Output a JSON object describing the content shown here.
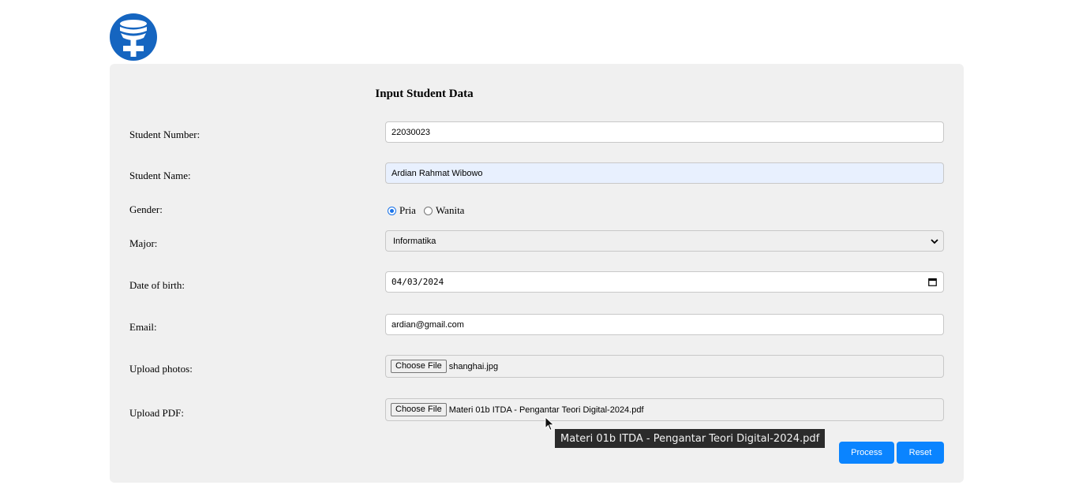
{
  "form": {
    "title": "Input Student Data",
    "student_number": {
      "label": "Student Number:",
      "value": "22030023"
    },
    "student_name": {
      "label": "Student Name:",
      "value": "Ardian Rahmat Wibowo"
    },
    "gender": {
      "label": "Gender:",
      "options": [
        {
          "label": "Pria",
          "checked": true
        },
        {
          "label": "Wanita",
          "checked": false
        }
      ]
    },
    "major": {
      "label": "Major:",
      "value": "Informatika"
    },
    "dob": {
      "label": "Date of birth:",
      "value": "04/03/2024"
    },
    "email": {
      "label": "Email:",
      "value": "ardian@gmail.com"
    },
    "photo": {
      "label": "Upload photos:",
      "button": "Choose File",
      "filename": "shanghai.jpg"
    },
    "pdf": {
      "label": "Upload PDF:",
      "button": "Choose File",
      "filename": "Materi 01b ITDA - Pengantar Teori Digital-2024.pdf"
    },
    "process_button": "Process",
    "reset_button": "Reset"
  },
  "tooltip": "Materi 01b ITDA - Pengantar Teori Digital-2024.pdf",
  "colors": {
    "primary": "#0a84ff",
    "logo": "#1565c0",
    "card_bg": "#f0f0f0",
    "autofill_bg": "#e8f0fe"
  },
  "icons": {
    "logo": "database-plus-icon",
    "select": "chevron-down-icon",
    "date": "calendar-icon",
    "pointer": "mouse-cursor-icon"
  }
}
